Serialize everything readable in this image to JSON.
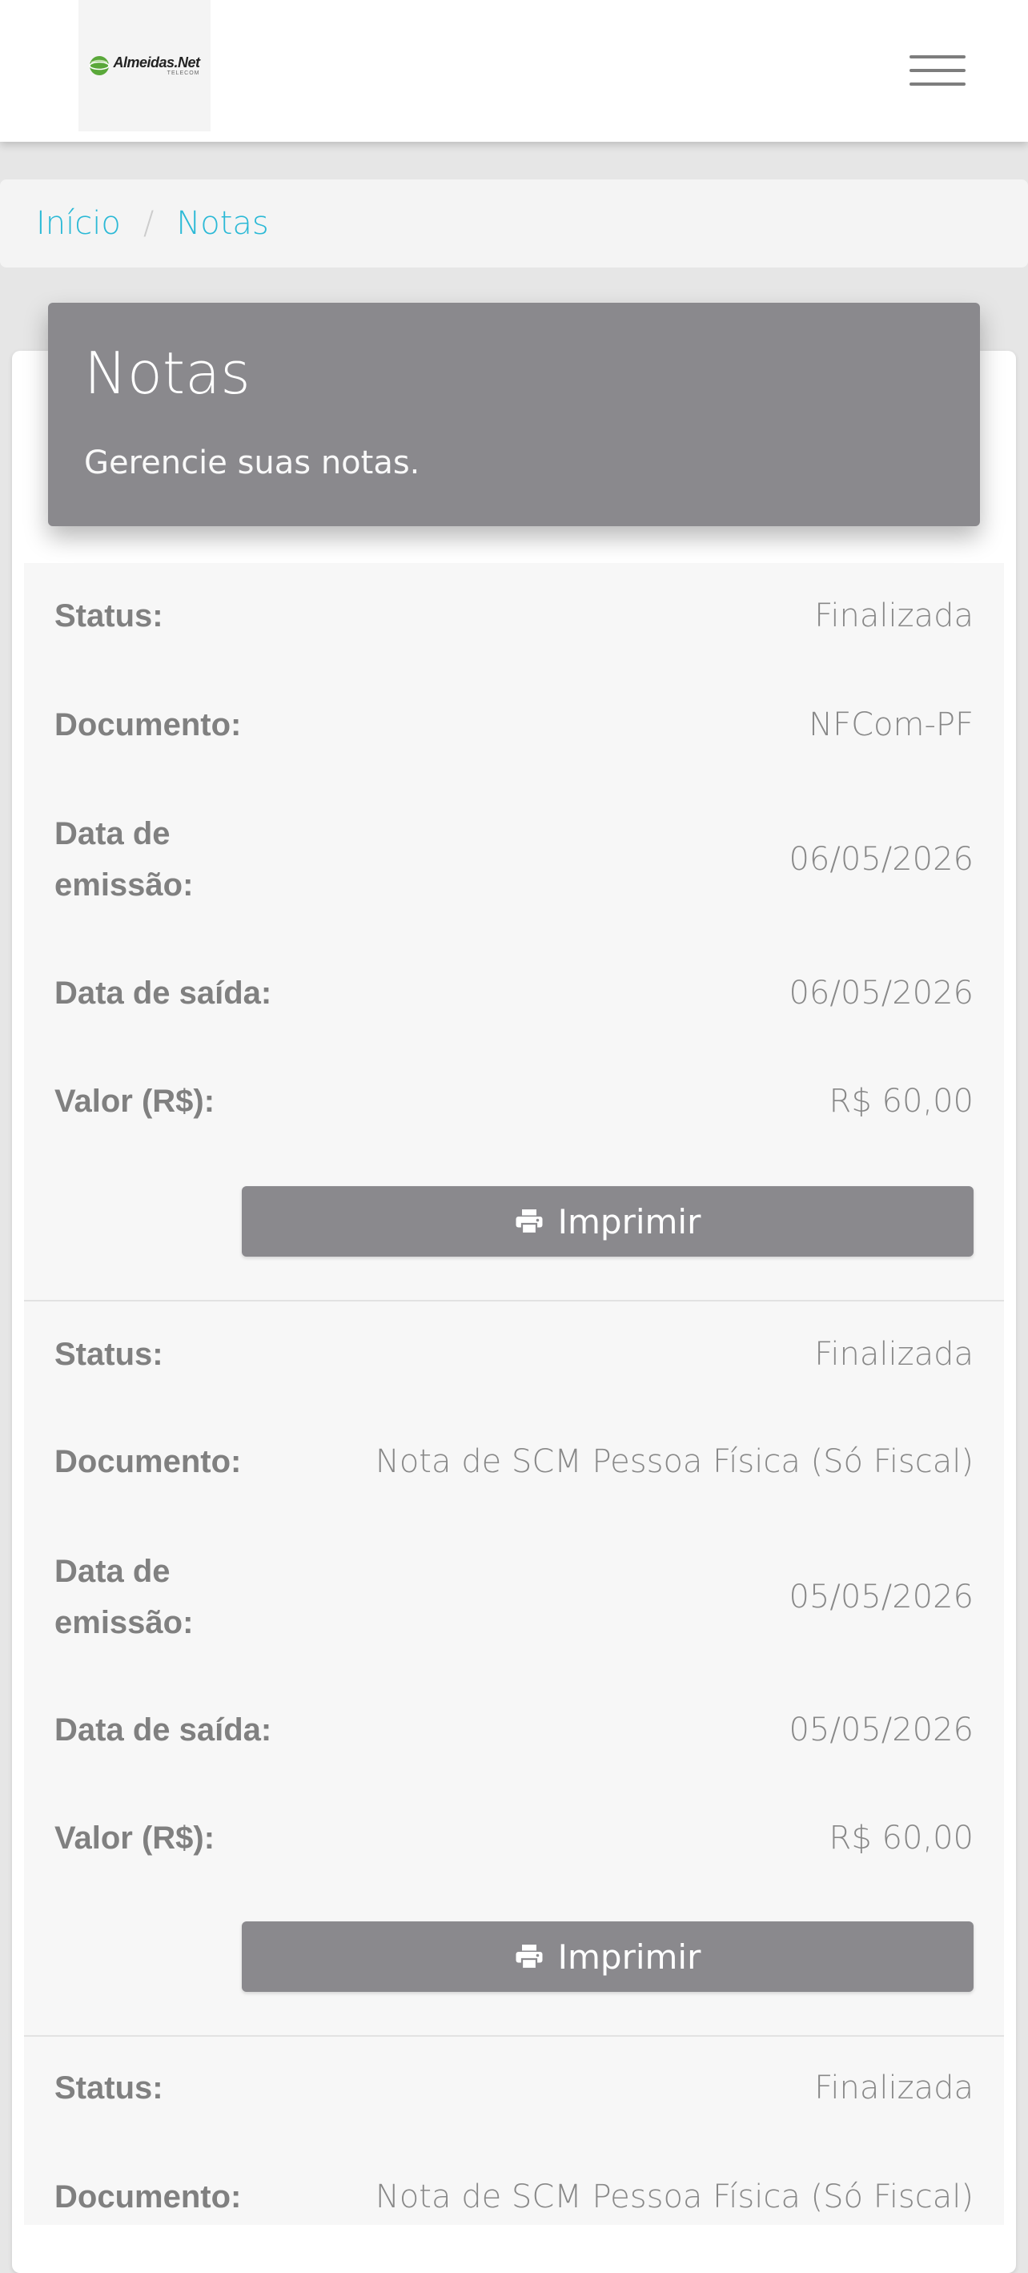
{
  "header": {
    "logo_name": "Almeidas.Net",
    "logo_sub": "TELECOM",
    "menu_icon": "hamburger-menu-icon"
  },
  "breadcrumb": {
    "home": "Início",
    "separator": "/",
    "current": "Notas"
  },
  "page": {
    "title": "Notas",
    "subtitle": "Gerencie suas notas."
  },
  "labels": {
    "status": "Status:",
    "documento": "Documento:",
    "data_emissao": "Data de emissão:",
    "data_saida": "Data de saída:",
    "valor": "Valor (R$):",
    "print_button": "Imprimir"
  },
  "notes": [
    {
      "status": "Finalizada",
      "documento": "NFCom-PF",
      "data_emissao": "06/05/2026",
      "data_saida": "06/05/2026",
      "valor": "R$ 60,00"
    },
    {
      "status": "Finalizada",
      "documento": "Nota de SCM Pessoa Física (Só Fiscal)",
      "data_emissao": "05/05/2026",
      "data_saida": "05/05/2026",
      "valor": "R$ 60,00"
    },
    {
      "status": "Finalizada",
      "documento": "Nota de SCM Pessoa Física (Só Fiscal)"
    }
  ],
  "colors": {
    "accent_link": "#2bb9d6",
    "header_card": "#8a898d",
    "button": "#8a898d",
    "label_text": "#808080",
    "logo_green": "#5aa83a"
  }
}
